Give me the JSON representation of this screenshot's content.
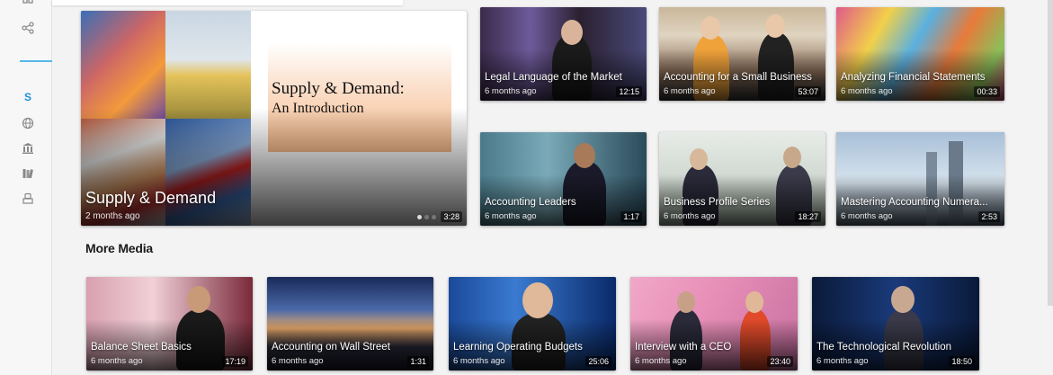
{
  "sidebar": {
    "icons": [
      "grid-icon",
      "share-icon",
      "brand-s-icon",
      "globe-icon",
      "library-icon",
      "books-icon",
      "podium-icon"
    ],
    "brand_letter": "S",
    "accent": "#55b8e8"
  },
  "featured": {
    "title": "Supply & Demand",
    "age": "2 months ago",
    "duration": "3:28",
    "slide_title": "Supply & Demand:",
    "slide_subtitle": "An Introduction"
  },
  "grid": [
    {
      "title": "Legal Language of the Market",
      "age": "6 months ago",
      "duration": "12:15"
    },
    {
      "title": "Accounting for a Small Business",
      "age": "6 months ago",
      "duration": "53:07"
    },
    {
      "title": "Analyzing Financial Statements",
      "age": "6 months ago",
      "duration": "00:33"
    },
    {
      "title": "Accounting Leaders",
      "age": "6 months ago",
      "duration": "1:17"
    },
    {
      "title": "Business Profile Series",
      "age": "6 months ago",
      "duration": "18:27"
    },
    {
      "title": "Mastering Accounting Numera...",
      "age": "6 months ago",
      "duration": "2:53"
    }
  ],
  "more_media": {
    "heading": "More Media",
    "items": [
      {
        "title": "Balance Sheet Basics",
        "age": "6 months ago",
        "duration": "17:19"
      },
      {
        "title": "Accounting on Wall Street",
        "age": "6 months ago",
        "duration": "1:31"
      },
      {
        "title": "Learning Operating Budgets",
        "age": "6 months ago",
        "duration": "25:06"
      },
      {
        "title": "Interview with a CEO",
        "age": "6 months ago",
        "duration": "23:40"
      },
      {
        "title": "The Technological Revolution",
        "age": "6 months ago",
        "duration": "18:50"
      }
    ]
  }
}
